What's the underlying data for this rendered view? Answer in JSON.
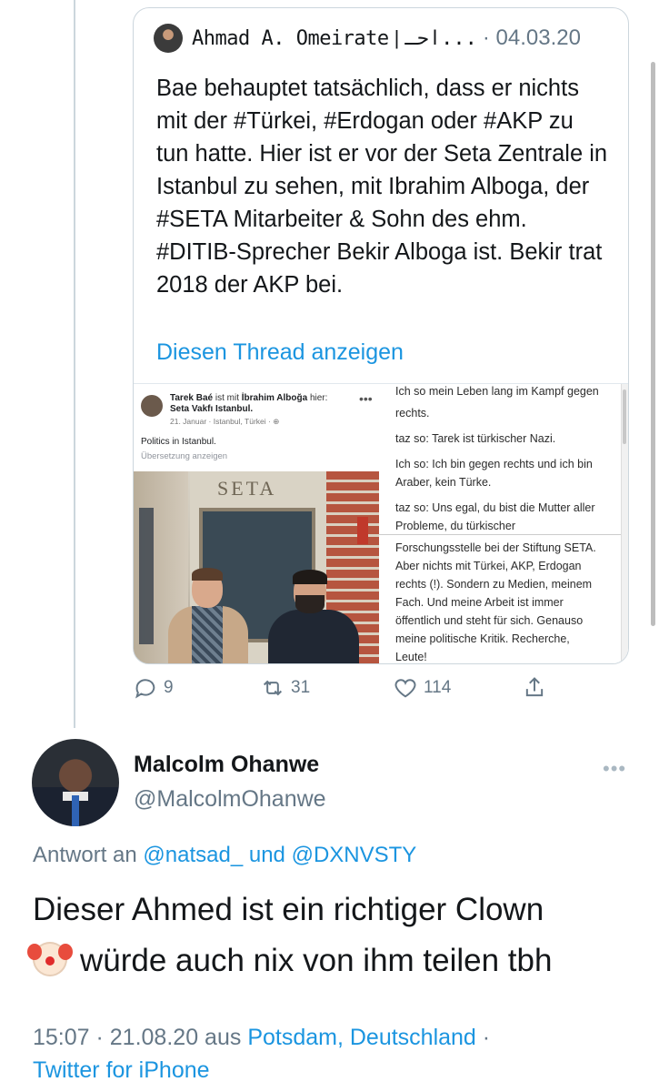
{
  "quoted_tweet": {
    "author": "Ahmad A. Omeirate",
    "author_suffix": "احـ...",
    "separator": "|",
    "date": "· 04.03.20",
    "text": "Bae behauptet tatsächlich, dass er nichts mit der #Türkei, #Erdogan oder #AKP zu tun hatte. Hier ist er vor der Seta Zentrale in Istanbul zu sehen, mit Ibrahim Alboga, der #SETA Mitarbeiter & Sohn des ehm. #DITIB-Sprecher Bekir Alboga ist. Bekir trat 2018 der AKP bei.",
    "show_thread": "Diesen Thread anzeigen",
    "media": {
      "fb_post": {
        "author": "Tarek Baé",
        "with_text": "ist mit",
        "tagged": "İbrahim Alboğa",
        "here_text": "hier:",
        "place": "Seta Vakfı Istanbul.",
        "meta": "21. Januar · Istanbul, Türkei · ⊕",
        "text": "Politics in Istanbul.",
        "translate": "Übersetzung anzeigen",
        "sign": "SETA"
      },
      "chat_top": [
        "Ich so mein Leben lang im Kampf gegen",
        "rechts.",
        "taz so: Tarek ist türkischer Nazi.",
        "Ich so: Ich bin gegen rechts und ich bin",
        "Araber, kein Türke.",
        "taz so: Uns egal, du bist die Mutter aller",
        "Probleme, du türkischer"
      ],
      "chat_bottom": [
        "Forschungsstelle bei der Stiftung SETA.",
        "Aber nichts mit Türkei, AKP, Erdogan",
        "rechts (!). Sondern zu Medien, meinem",
        "Fach. Und meine Arbeit ist immer",
        "öffentlich und steht für sich. Genauso",
        "meine politische Kritik. Recherche,",
        "Leute!"
      ]
    },
    "stats": {
      "replies": "9",
      "retweets": "31",
      "likes": "114"
    }
  },
  "reply_tweet": {
    "name": "Malcolm Ohanwe",
    "handle": "@MalcolmOhanwe",
    "more": "•••",
    "replying_prefix": "Antwort an",
    "mention1": "@natsad_",
    "and_word": "und",
    "mention2": "@DXNVSTY",
    "text_line1": "Dieser Ahmed ist ein richtiger Clown",
    "text_line2": "würde auch nix von ihm teilen tbh",
    "time": "15:07 · 21.08.20 aus",
    "location": "Potsdam, Deutschland",
    "dot": "·",
    "client": "Twitter for iPhone"
  },
  "colors": {
    "link": "#1b95e0",
    "muted": "#657786",
    "text": "#14171a",
    "border": "#ccd6dd"
  },
  "icons": [
    "reply-icon",
    "retweet-icon",
    "like-icon",
    "share-icon",
    "clown-face-icon"
  ]
}
